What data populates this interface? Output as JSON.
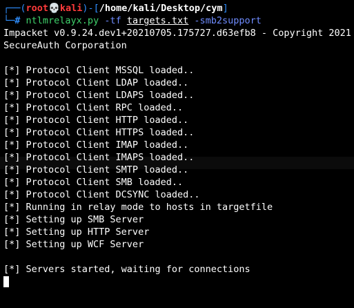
{
  "colors": {
    "background": "#000000",
    "prompt_frame": "#2f8fff",
    "prompt_user": "#ff3b3b",
    "command": "#3fd26b",
    "argument": "#6f8cff",
    "text": "#ffffff"
  },
  "prompt": {
    "top_frame": "┌──(",
    "user": "root",
    "skull": "💀",
    "host": "kali",
    "mid_frame": ")-[",
    "path": "/home/kali/Desktop/cym",
    "end_frame": "]",
    "bottom_frame": "└─",
    "hash": "# "
  },
  "command": {
    "name": "ntlmrelayx.py",
    "flag_tf": " -tf ",
    "file": "targets.txt",
    "flag_smb2": " -smb2support"
  },
  "header": {
    "line1": "Impacket v0.9.24.dev1+20210705.175727.d63efb8 - Copyright 2021",
    "line2": "SecureAuth Corporation"
  },
  "output_lines": [
    "[*] Protocol Client MSSQL loaded..",
    "[*] Protocol Client LDAP loaded..",
    "[*] Protocol Client LDAPS loaded..",
    "[*] Protocol Client RPC loaded..",
    "[*] Protocol Client HTTP loaded..",
    "[*] Protocol Client HTTPS loaded..",
    "[*] Protocol Client IMAP loaded..",
    "[*] Protocol Client IMAPS loaded..",
    "[*] Protocol Client SMTP loaded..",
    "[*] Protocol Client SMB loaded..",
    "[*] Protocol Client DCSYNC loaded..",
    "[*] Running in relay mode to hosts in targetfile",
    "[*] Setting up SMB Server",
    "[*] Setting up HTTP Server",
    "[*] Setting up WCF Server"
  ],
  "final_line": "[*] Servers started, waiting for connections"
}
